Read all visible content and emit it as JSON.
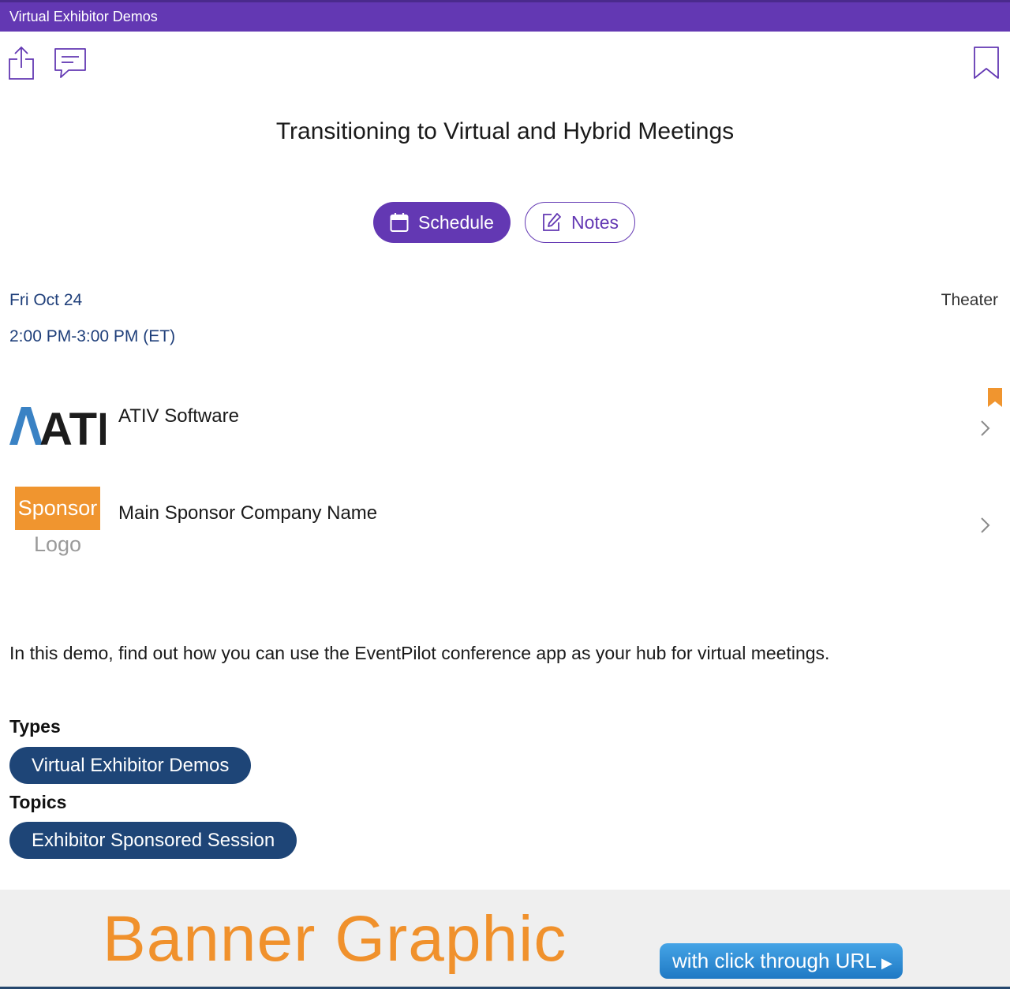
{
  "header": {
    "title": "Virtual Exhibitor Demos",
    "accent_color": "#6338b3"
  },
  "toolbar": {
    "share_icon": "share-icon",
    "comment_icon": "comment-icon",
    "bookmark_icon": "bookmark-icon"
  },
  "session": {
    "title": "Transitioning to Virtual and Hybrid Meetings",
    "date": "Fri Oct 24",
    "time": "2:00 PM-3:00 PM (ET)",
    "room": "Theater",
    "description": "In this demo, find out how you can use the EventPilot conference app as your hub for virtual meetings."
  },
  "actions": {
    "schedule_label": "Schedule",
    "notes_label": "Notes"
  },
  "exhibitors": [
    {
      "name": "ATIV Software",
      "logo_text": "ATIV",
      "bookmarked": true
    },
    {
      "name": "Main Sponsor Company Name",
      "logo_text": "Sponsor",
      "logo_subtext": "Logo",
      "bookmarked": false
    }
  ],
  "types": {
    "heading": "Types",
    "items": [
      "Virtual Exhibitor Demos"
    ]
  },
  "topics": {
    "heading": "Topics",
    "items": [
      "Exhibitor Sponsored Session"
    ]
  },
  "banner": {
    "text": "Banner Graphic",
    "link_label": "with click through URL"
  },
  "colors": {
    "primary": "#6338b3",
    "tag": "#1e4577",
    "date_text": "#1f3f7a",
    "bookmark_flag": "#f0952f",
    "banner_text": "#f0912c"
  }
}
